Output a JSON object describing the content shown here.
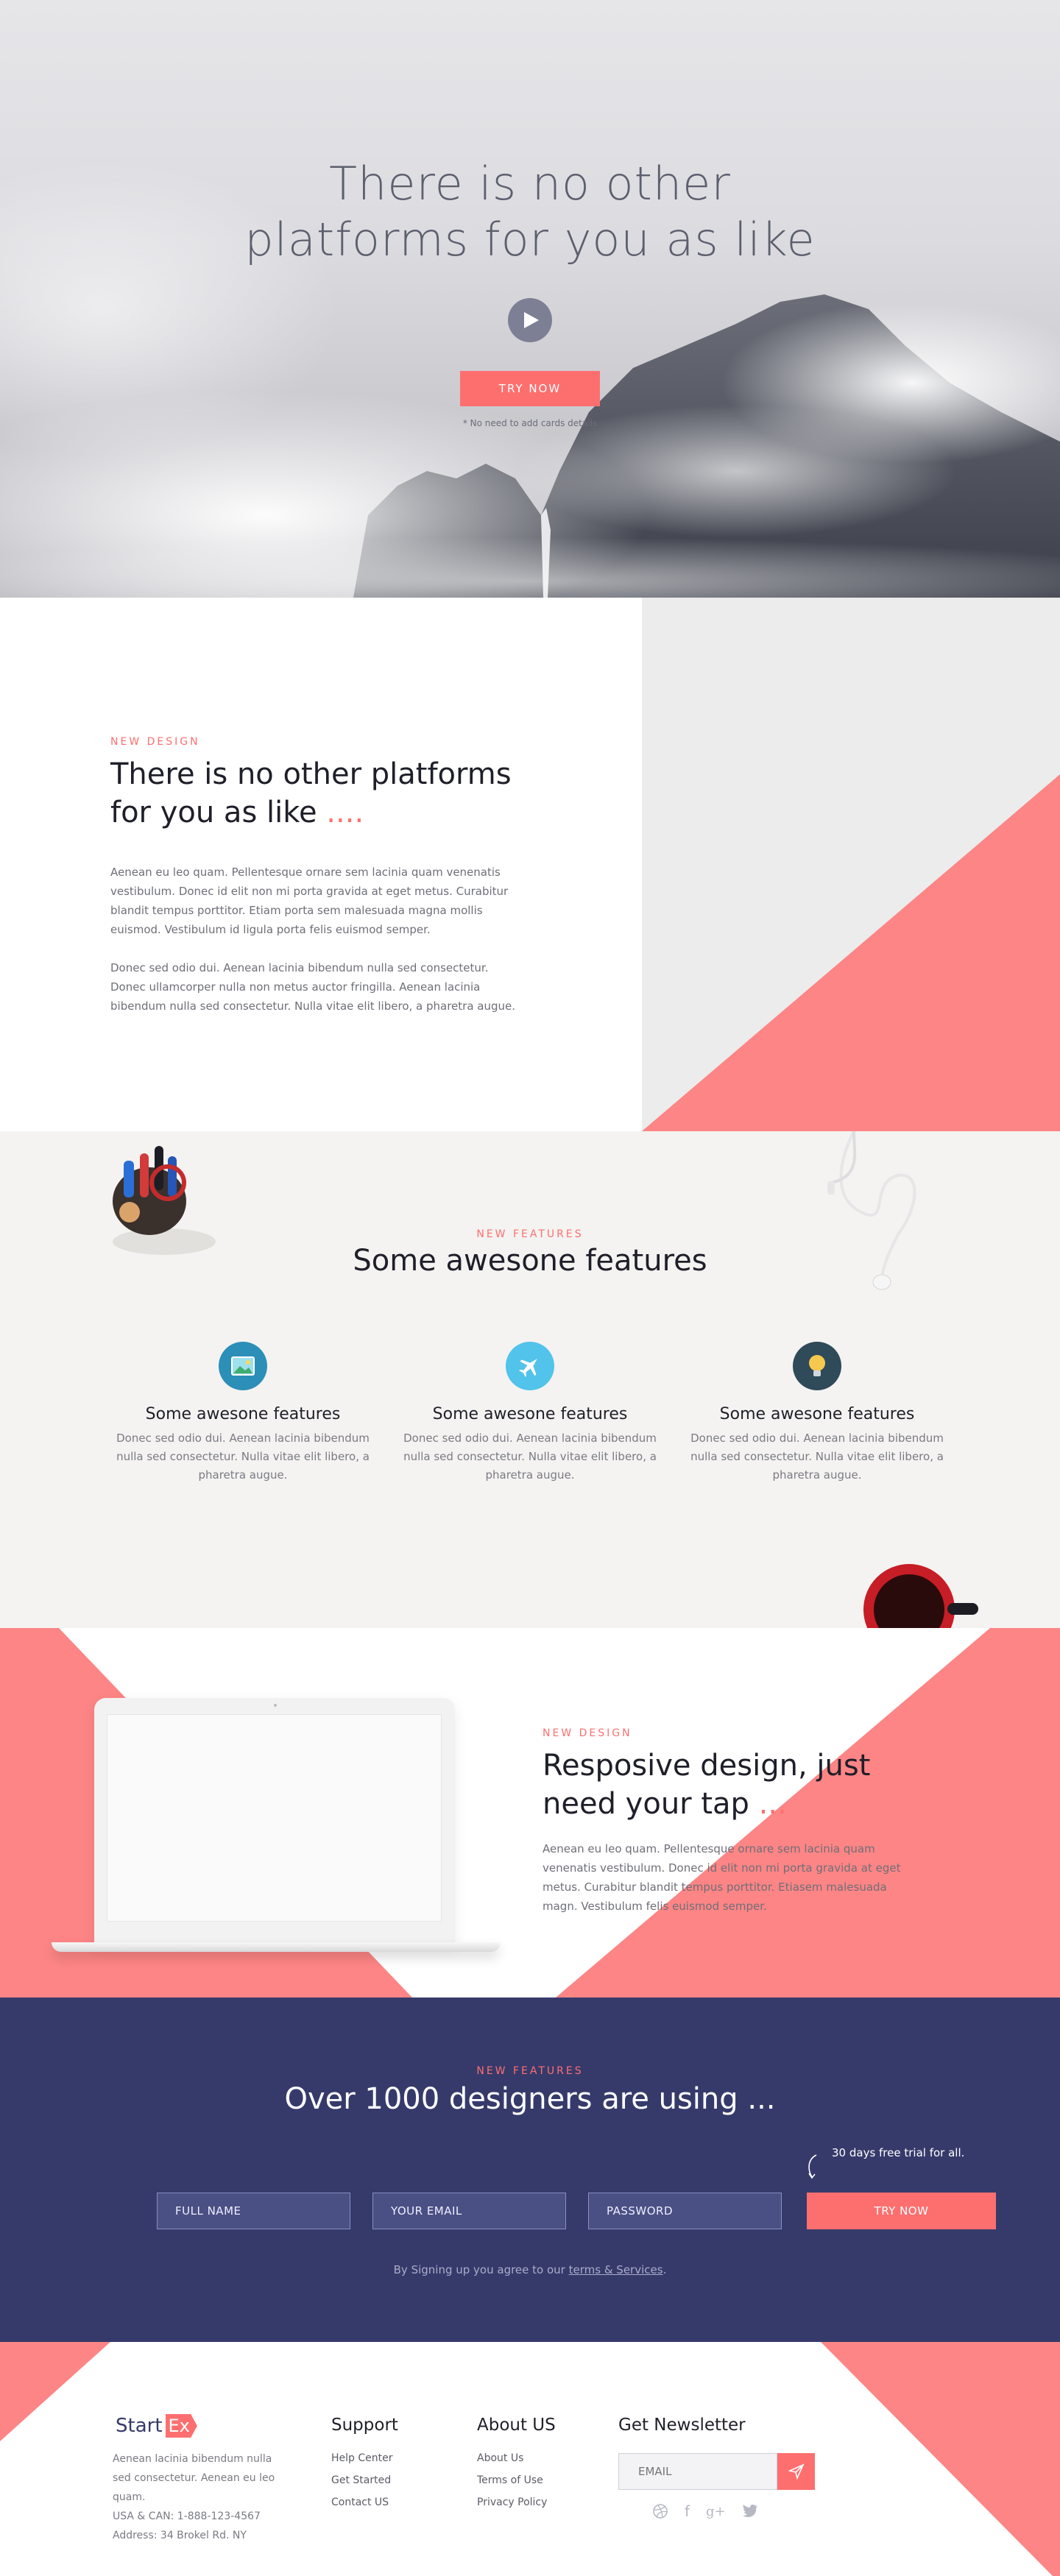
{
  "hero": {
    "title_line1": "There is no other",
    "title_line2": "platforms for you as like",
    "cta": "TRY NOW",
    "note": "* No need to add cards details"
  },
  "design": {
    "eyebrow": "NEW DESIGN",
    "title_line1": "There is no other platforms",
    "title_line2": "for you as like",
    "title_dots": "....",
    "para1": "Aenean eu leo quam. Pellentesque ornare sem lacinia quam venenatis vestibulum. Donec id elit non mi porta gravida at eget metus. Curabitur blandit tempus porttitor. Etiam porta sem malesuada magna mollis euismod. Vestibulum id ligula porta felis euismod semper.",
    "para2": "Donec sed odio dui. Aenean lacinia bibendum nulla sed consectetur. Donec ullamcorper nulla non metus auctor fringilla. Aenean lacinia bibendum nulla sed consectetur. Nulla vitae elit libero, a pharetra augue."
  },
  "features": {
    "eyebrow": "NEW FEATURES",
    "title": "Some awesone features",
    "items": [
      {
        "icon": "picture-icon",
        "color": "#2b8fb8",
        "title": "Some awesone features",
        "text": "Donec sed odio dui. Aenean lacinia bibendum nulla sed consectetur. Nulla vitae elit libero, a pharetra augue."
      },
      {
        "icon": "airplane-icon",
        "color": "#52c3ea",
        "title": "Some awesone features",
        "text": "Donec sed odio dui. Aenean lacinia bibendum nulla sed consectetur. Nulla vitae elit libero, a pharetra augue."
      },
      {
        "icon": "lightbulb-icon",
        "color": "#2f4a59",
        "title": "Some awesone features",
        "text": "Donec sed odio dui. Aenean lacinia bibendum nulla sed consectetur. Nulla vitae elit libero, a pharetra augue."
      }
    ]
  },
  "responsive": {
    "eyebrow": "NEW DESIGN",
    "title_line1": "Resposive design, just",
    "title_line2": "need your tap",
    "title_dots": "...",
    "para": "Aenean eu leo quam. Pellentesque ornare sem lacinia quam venenatis vestibulum. Donec id elit non mi porta gravida at eget metus. Curabitur blandit tempus porttitor. Etiasem malesuada magn. Vestibulum felis euismod semper."
  },
  "signup": {
    "eyebrow": "NEW FEATURES",
    "title": "Over 1000 designers are using ...",
    "trial_note": "30 days free trial for all.",
    "full_name_placeholder": "FULL NAME",
    "email_placeholder": "YOUR EMAIL",
    "password_placeholder": "PASSWORD",
    "cta": "TRY NOW",
    "terms_prefix": "By Signing up you agree to our",
    "terms_link": "terms & Services",
    "terms_suffix": "."
  },
  "footer": {
    "logo_start": "Start",
    "logo_ex": "Ex",
    "about_text": "Aenean lacinia bibendum nulla sed consectetur. Aenean eu leo quam.",
    "contact_line": "USA &  CAN: 1-888-123-4567",
    "address_line": "Address: 34 Brokel Rd. NY",
    "support_title": "Support",
    "support_links": [
      "Help Center",
      "Get Started",
      "Contact US"
    ],
    "about_title": "About US",
    "about_links": [
      "About Us",
      "Terms of Use",
      "Privacy Policy"
    ],
    "newsletter_title": "Get Newsletter",
    "newsletter_placeholder": "EMAIL",
    "social": [
      "dribbble-icon",
      "facebook-icon",
      "google-plus-icon",
      "twitter-icon"
    ],
    "social_labels": {
      "facebook": "f",
      "google": "g+"
    }
  },
  "colors": {
    "accent": "#fd6f6f",
    "navy": "#363a6b",
    "heading": "#1f1f2a",
    "body_text": "#6e6f78"
  }
}
